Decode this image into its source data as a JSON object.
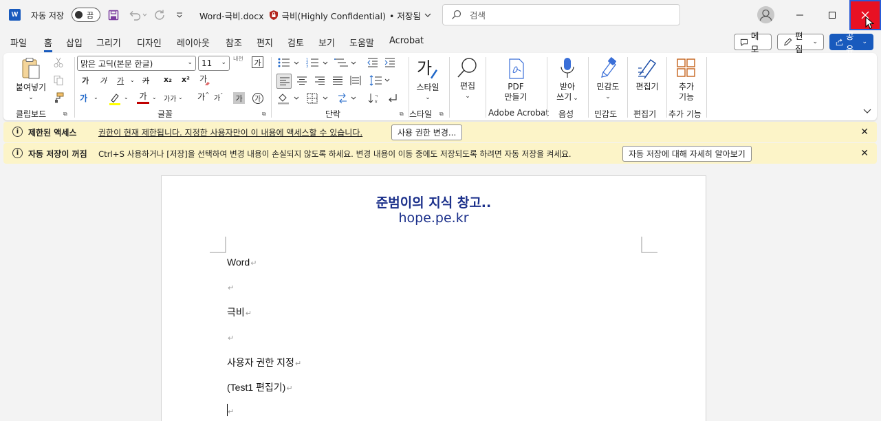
{
  "titlebar": {
    "app_icon": "W",
    "autosave_label": "자동 저장",
    "autosave_state": "끔",
    "doc_name": "Word-극비.docx",
    "sensitivity": "극비(Highly Confidential)",
    "save_state": "• 저장됨",
    "search_placeholder": "검색"
  },
  "menu": {
    "tabs": [
      "파일",
      "홈",
      "삽입",
      "그리기",
      "디자인",
      "레이아웃",
      "참조",
      "편지",
      "검토",
      "보기",
      "도움말",
      "Acrobat"
    ],
    "active_tab": "홈",
    "memo": "메모",
    "edit": "편집",
    "share": "공유"
  },
  "ribbon": {
    "clipboard": {
      "paste": "붙여넣기",
      "label": "클립보드"
    },
    "font": {
      "name": "맑은 고딕(본문 한글)",
      "size": "11",
      "label": "글꼴",
      "bold": "가",
      "italic": "가",
      "underline": "가",
      "strike": "가",
      "sub": "x₂",
      "sup": "x²",
      "color": "가",
      "grow": "가",
      "shrink": "가",
      "charshade": "가",
      "phonetic": "내천",
      "charborder": "가",
      "case": "가가",
      "highlight_color": "#ffff00",
      "font_color": "#c00000"
    },
    "paragraph": {
      "label": "단락"
    },
    "styles": {
      "btn": "스타일",
      "label": "스타일"
    },
    "editing": {
      "btn": "편집"
    },
    "adobe": {
      "btn1": "PDF",
      "btn2": "만들기",
      "label": "Adobe Acrobat"
    },
    "voice": {
      "btn1": "받아",
      "btn2": "쓰기",
      "label": "음성"
    },
    "sensitivity": {
      "btn": "민감도",
      "label": "민감도"
    },
    "editor": {
      "btn": "편집기",
      "label": "편집기"
    },
    "addins": {
      "btn1": "추가",
      "btn2": "기능",
      "label": "추가 기능"
    }
  },
  "infobars": [
    {
      "title": "제한된 액세스",
      "message": "권한이 현재 제한됩니다. 지정한 사용자만이 이 내용에 액세스할 수 있습니다.",
      "button": "사용 권한 변경..."
    },
    {
      "title": "자동 저장이 꺼짐",
      "message": "Ctrl+S 사용하거나 [저장]을 선택하여 변경 내용이 손실되지 않도록 하세요. 변경 내용이 이동 중에도 저장되도록 하려면 자동 저장을 켜세요.",
      "button": "자동 저장에 대해 자세히 알아보기"
    }
  ],
  "document": {
    "watermark_line1": "준범이의 지식 창고..",
    "watermark_line2": "hope.pe.kr",
    "paragraphs": [
      "Word",
      "",
      "극비",
      "",
      "사용자 권한 지정",
      "(Test1 편집기)",
      ""
    ],
    "para_mark": "↵"
  },
  "colors": {
    "accent": "#185abd",
    "close_red": "#e81123",
    "infobar_bg": "#fcf4c8",
    "watermark": "#1a2f8a"
  }
}
